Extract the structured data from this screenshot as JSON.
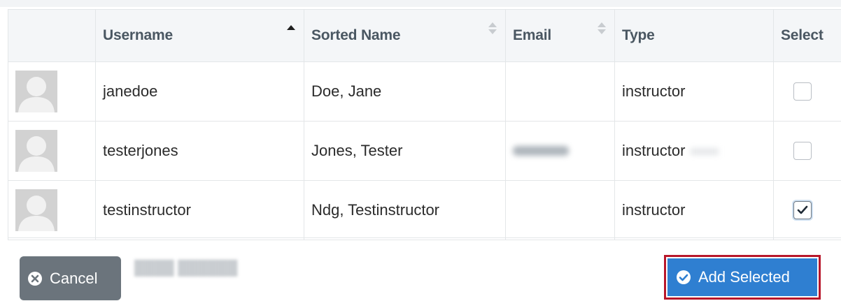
{
  "table": {
    "columns": [
      {
        "key": "avatar",
        "label": "",
        "sort": "none"
      },
      {
        "key": "username",
        "label": "Username",
        "sort": "asc"
      },
      {
        "key": "sorted_name",
        "label": "Sorted Name",
        "sort": "both"
      },
      {
        "key": "email",
        "label": "Email",
        "sort": "both"
      },
      {
        "key": "type",
        "label": "Type",
        "sort": "none"
      },
      {
        "key": "select",
        "label": "Select",
        "sort": "none"
      }
    ],
    "rows": [
      {
        "username": "janedoe",
        "sorted_name": "Doe, Jane",
        "email": "",
        "email_obscured": false,
        "type": "instructor",
        "selected": false
      },
      {
        "username": "testerjones",
        "sorted_name": "Jones, Tester",
        "email": "",
        "email_obscured": true,
        "type": "instructor",
        "selected": false
      },
      {
        "username": "testinstructor",
        "sorted_name": "Ndg, Testinstructor",
        "email": "",
        "email_obscured": false,
        "type": "instructor",
        "selected": true
      }
    ]
  },
  "footer": {
    "cancel_label": "Cancel",
    "cancel_icon": "times-circle-icon",
    "add_label": "Add Selected",
    "add_icon": "check-circle-icon"
  },
  "colors": {
    "add_button": "#2f7fd1",
    "cancel_button": "#6b747c",
    "highlight_border": "#b8172a"
  }
}
